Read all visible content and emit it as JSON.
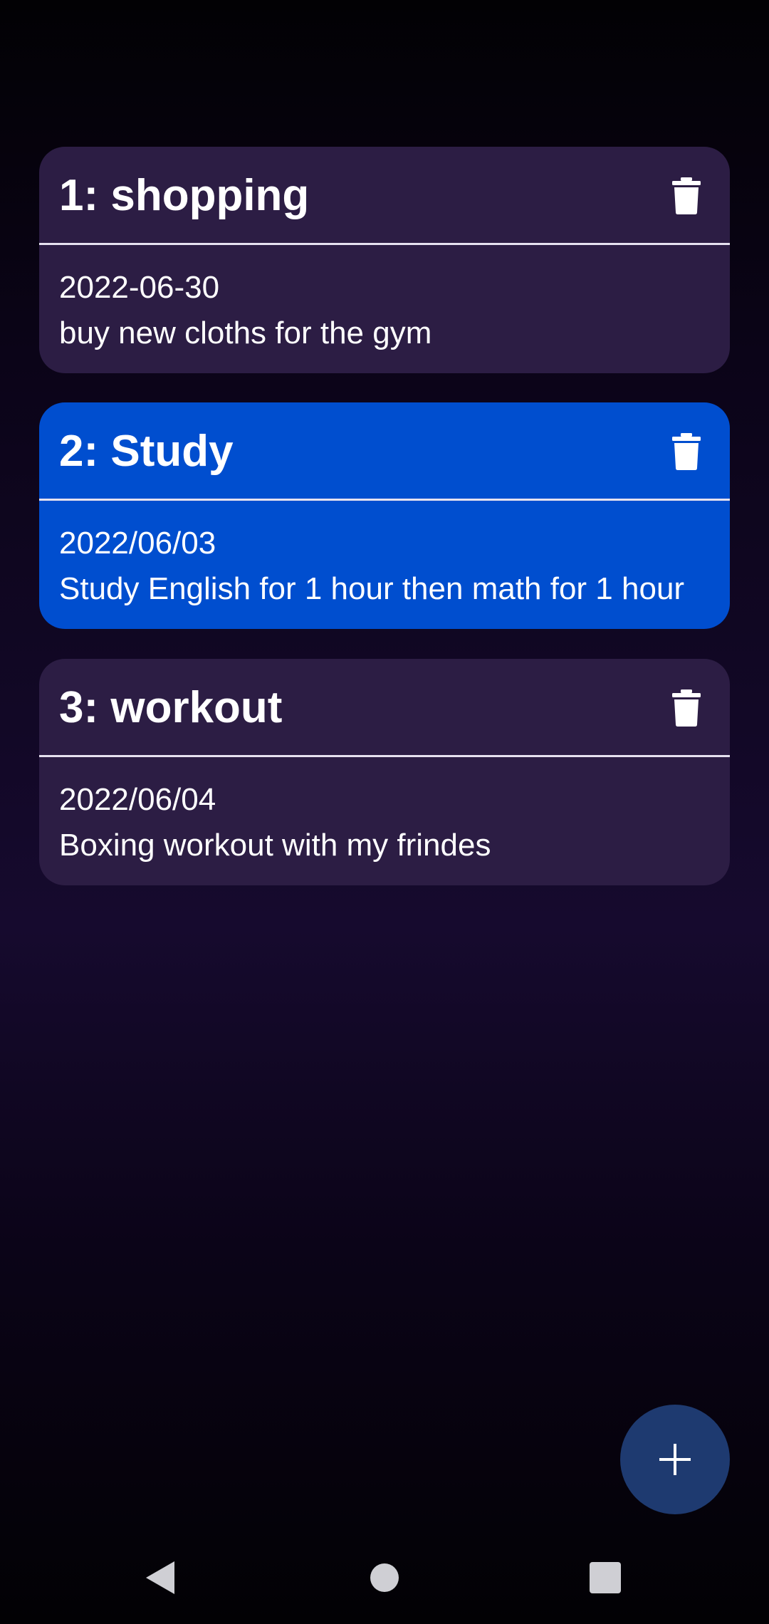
{
  "tasks": [
    {
      "title": "1: shopping",
      "date": "2022-06-30",
      "description": "buy new cloths for the gym",
      "selected": false,
      "delete_icon": "trash-icon"
    },
    {
      "title": "2: Study",
      "date": "2022/06/03",
      "description": "Study English for 1 hour then math for 1 hour",
      "selected": true,
      "delete_icon": "trash-icon"
    },
    {
      "title": "3: workout",
      "date": "2022/06/04",
      "description": "Boxing workout with my frindes",
      "selected": false,
      "delete_icon": "trash-icon"
    }
  ],
  "fab": {
    "icon": "plus-icon"
  },
  "navigation_bar": {
    "back_icon": "triangle-back-icon",
    "home_icon": "circle-home-icon",
    "recents_icon": "square-recents-icon"
  },
  "colors": {
    "card_background": "#2c1d44",
    "card_selected_background": "#004ecf",
    "fab_background": "#1e3a70",
    "text": "#ffffff"
  }
}
